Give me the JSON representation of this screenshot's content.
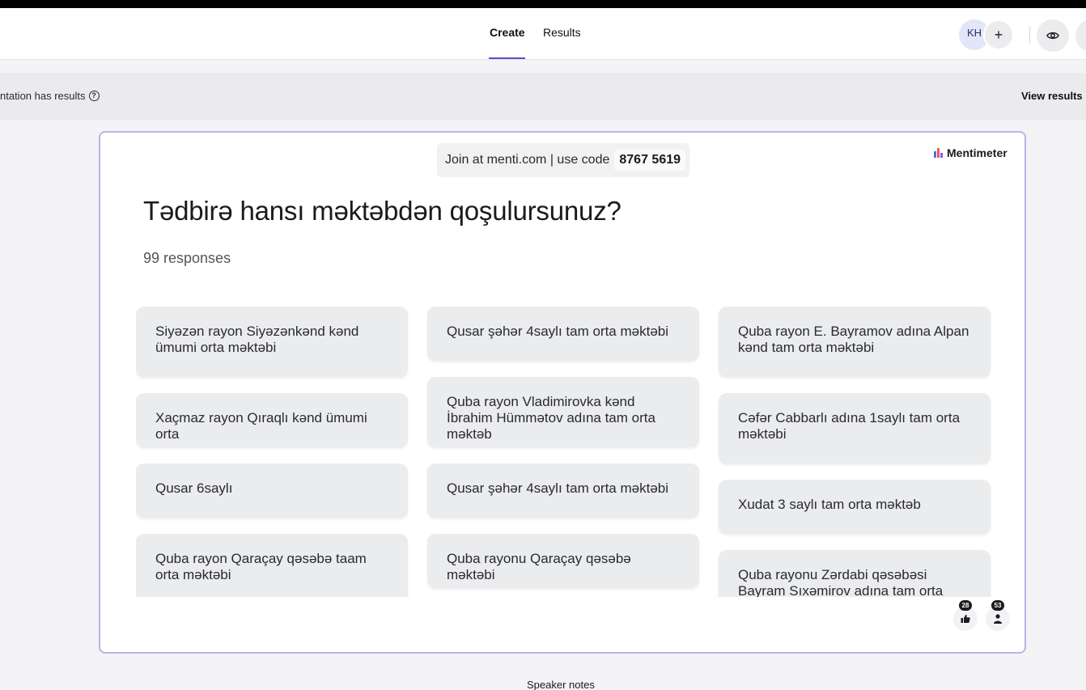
{
  "header": {
    "tabs": [
      {
        "label": "Create",
        "active": true
      },
      {
        "label": "Results",
        "active": false
      }
    ],
    "avatar_initials": "KH",
    "add_icon": "plus-icon",
    "preview_icon": "eye-icon"
  },
  "banner": {
    "text": "ntation has results",
    "action": "View results"
  },
  "slide": {
    "join_prefix": "Join at menti.com | use code",
    "join_code": "8767 5619",
    "brand": "Mentimeter",
    "question": "Tədbirə hansı məktəbdən qoşulursunuz?",
    "responses": "99 responses",
    "answers": [
      "Siyəzən rayon Siyəzənkənd kənd ümumi orta məktəbi",
      "Qusar şəhər 4saylı tam orta məktəbi",
      "Quba rayon E. Bayramov adına Alpan kənd tam orta məktəbi",
      "Xaçmaz rayon Qıraqlı kənd ümumi orta",
      "Quba rayon Vladimirovka kənd İbrahim Hümmətov adına tam orta məktəb",
      "Cəfər Cabbarlı adına 1saylı tam orta məktəbi",
      "Qusar 6saylı",
      "Qusar şəhər 4saylı tam orta məktəbi",
      "Xudat 3 saylı tam orta məktəb",
      "Quba rayon Qaraçay qəsəbə taam orta məktəbi",
      "Quba rayonu Qaraçay qəsəbə məktəbi",
      "Quba rayonu Zərdabi qəsəbəsi Bayram Sıxəmirov adına tam orta ümumtəhsil"
    ],
    "reactions": [
      {
        "icon": "thumbs-up-icon",
        "count": "28"
      },
      {
        "icon": "person-icon",
        "count": "53"
      }
    ]
  },
  "footer": {
    "speaker_notes": "Speaker notes"
  },
  "colors": {
    "accent": "#5b4ec9",
    "card_bg": "#ebecee",
    "slide_border": "#b9b3e6"
  }
}
